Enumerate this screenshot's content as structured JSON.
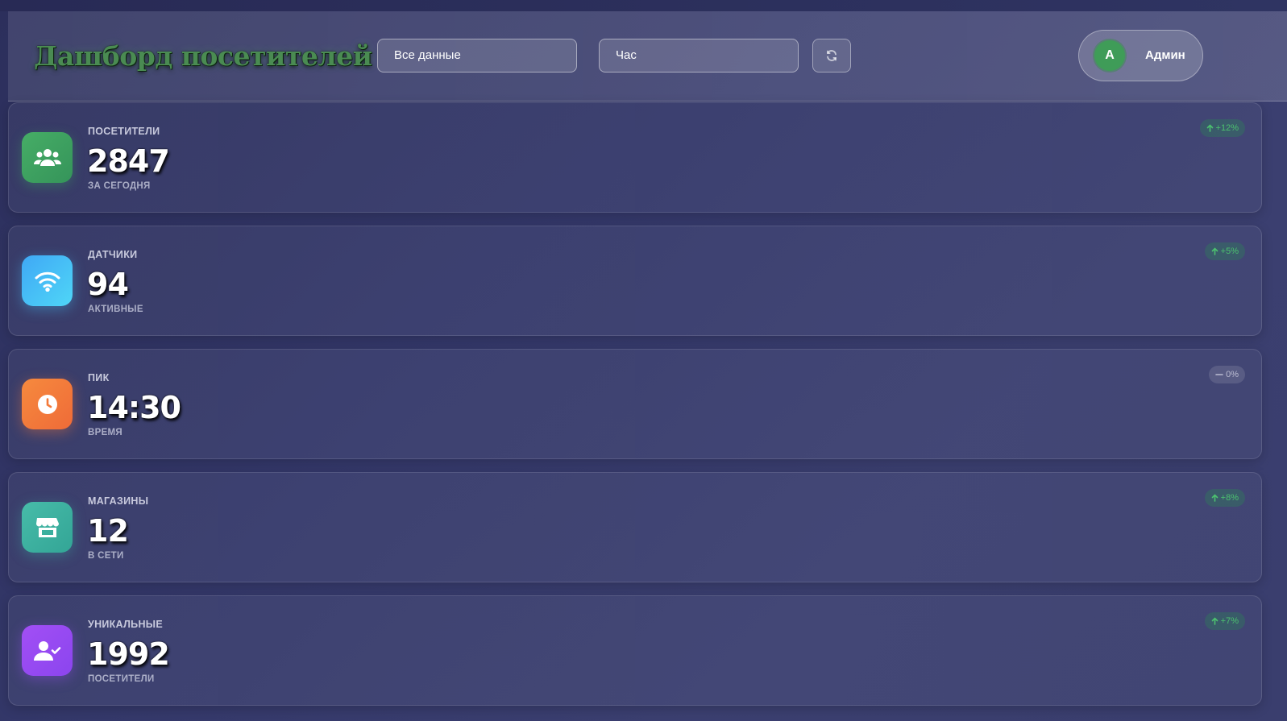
{
  "header": {
    "title": "Дашборд посетителей",
    "data_select_value": "Все данные",
    "period_select_value": "Час",
    "refresh_icon": "refresh-icon"
  },
  "user": {
    "avatar_initial": "A",
    "name": "Админ",
    "avatar_color": "#3f9c58"
  },
  "cards": [
    {
      "label": "ПОСЕТИТЕЛИ",
      "value": "2847",
      "sub": "ЗА СЕГОДНЯ",
      "trend": "+12%",
      "trend_dir": "up",
      "icon": "users-icon",
      "color": "#3fa45f"
    },
    {
      "label": "ДАТЧИКИ",
      "value": "94",
      "sub": "АКТИВНЫЕ",
      "trend": "+5%",
      "trend_dir": "up",
      "icon": "wifi-icon",
      "color": "#42b8f5"
    },
    {
      "label": "ПИК",
      "value": "14:30",
      "sub": "ВРЕМЯ",
      "trend": "0%",
      "trend_dir": "flat",
      "icon": "clock-icon",
      "color": "#f47a3a"
    },
    {
      "label": "МАГАЗИНЫ",
      "value": "12",
      "sub": "В СЕТИ",
      "trend": "+8%",
      "trend_dir": "up",
      "icon": "store-icon",
      "color": "#3fb5a4"
    },
    {
      "label": "УНИКАЛЬНЫЕ",
      "value": "1992",
      "sub": "ПОСЕТИТЕЛИ",
      "trend": "+7%",
      "trend_dir": "up",
      "icon": "user-check-icon",
      "color": "#9a4cf2"
    }
  ]
}
